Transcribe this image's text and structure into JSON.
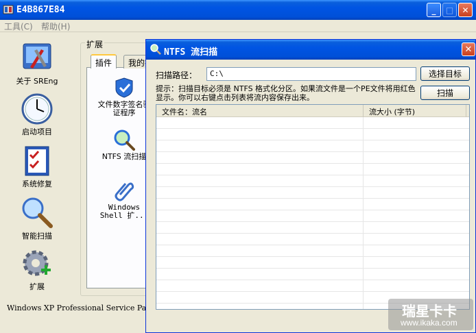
{
  "main_window": {
    "title": "E4B867E84",
    "menu": [
      "工具(C)",
      "帮助(H)"
    ],
    "nav": [
      {
        "label": "关于 SREng",
        "icon": "tools-icon"
      },
      {
        "label": "启动项目",
        "icon": "clock-icon"
      },
      {
        "label": "系统修复",
        "icon": "checklist-icon"
      },
      {
        "label": "智能扫描",
        "icon": "magnifier-icon"
      },
      {
        "label": "扩展",
        "icon": "gear-plus-icon"
      }
    ],
    "ext_group_label": "扩展",
    "tabs": [
      "插件",
      "我的扩"
    ],
    "plugins": [
      {
        "label": "文件数字签名验证程序",
        "icon": "shield-check-icon"
      },
      {
        "label": "NTFS 流扫描",
        "icon": "magnifier-icon"
      },
      {
        "label": "Windows Shell 扩...",
        "icon": "paperclip-icon"
      }
    ],
    "status": "Windows XP Professional Service Pa"
  },
  "dialog": {
    "title": "NTFS 流扫描",
    "path_label": "扫描路径：",
    "path_value": "C:\\",
    "select_button": "选择目标",
    "scan_button": "扫描",
    "hint": "提示：扫描目标必须是 NTFS 格式化分区。如果流文件是一个PE文件将用红色显示。你可以右键点击列表将流内容保存出来。",
    "columns": [
      "文件名：流名",
      "流大小 (字节)"
    ]
  },
  "watermark": {
    "logo": "瑞星卡卡",
    "url": "www.ikaka.com"
  },
  "colors": {
    "titlebar": "#0054e3",
    "close": "#c9401e",
    "window_bg": "#ece9d8"
  }
}
